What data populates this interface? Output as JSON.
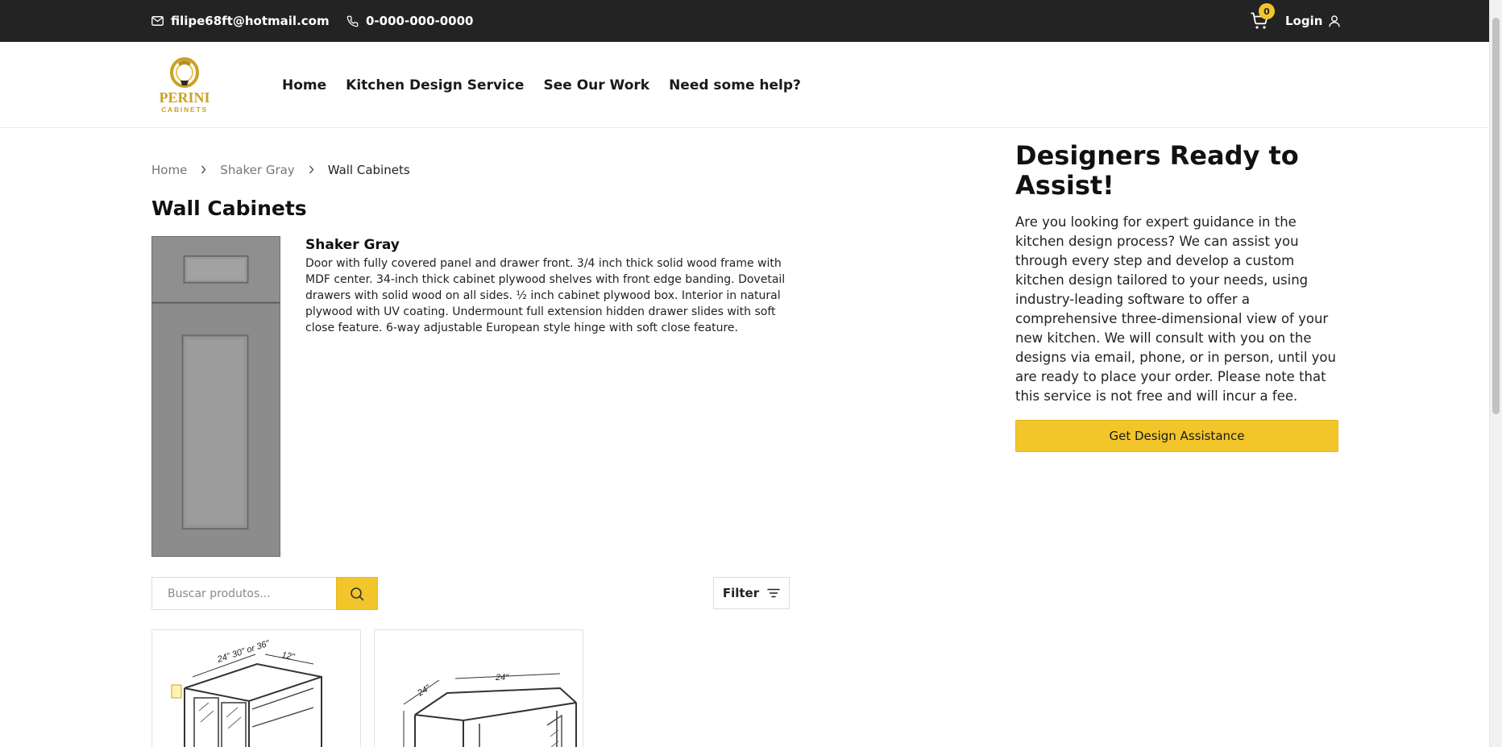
{
  "topbar": {
    "email": "filipe68ft@hotmail.com",
    "phone": "0-000-000-0000",
    "cart_count": "0",
    "login_label": "Login"
  },
  "header": {
    "logo_text": "PERINI",
    "logo_subtext": "CABINETS",
    "nav": [
      "Home",
      "Kitchen Design Service",
      "See Our Work",
      "Need some help?"
    ]
  },
  "breadcrumb": {
    "items": [
      "Home",
      "Shaker Gray",
      "Wall Cabinets"
    ]
  },
  "page": {
    "title": "Wall Cabinets",
    "collection_name": "Shaker Gray",
    "collection_description": "Door with fully covered panel and drawer front. 3/4 inch thick solid wood frame with MDF center. 34-inch thick cabinet plywood shelves with front edge banding. Dovetail drawers with solid wood on all sides. ½ inch cabinet plywood box. Interior in natural plywood with UV coating. Undermount full extension hidden drawer slides with soft close feature. 6-way adjustable European style hinge with soft close feature."
  },
  "search": {
    "placeholder": "Buscar produtos...",
    "filter_label": "Filter"
  },
  "products": [
    {
      "dimension_labels": [
        "24\" 30\" or 36\"",
        "12\""
      ]
    },
    {
      "dimension_labels": [
        "24\"",
        "24\""
      ]
    }
  ],
  "sidebar": {
    "title": "Designers Ready to Assist!",
    "text": "Are you looking for expert guidance in the kitchen design process? We can assist you through every step and develop a custom kitchen design tailored to your needs, using industry-leading software to offer a comprehensive three-dimensional view of your new kitchen. We will consult with you on the designs via email, phone, or in person, until you are ready to place your order. Please note that this service is not free and will incur a fee.",
    "button_label": "Get Design Assistance"
  },
  "colors": {
    "topbar_bg": "#232323",
    "accent": "#f2c52b"
  }
}
